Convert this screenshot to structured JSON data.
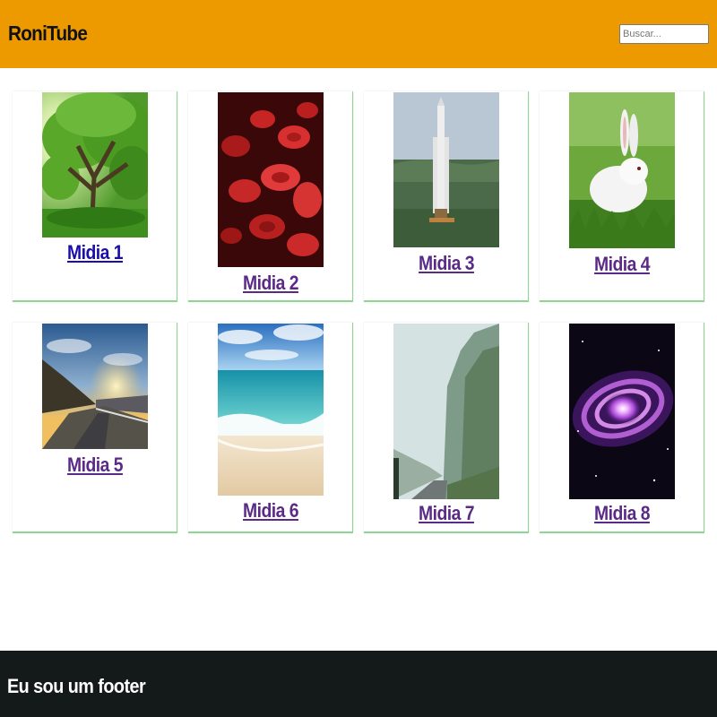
{
  "header": {
    "brand": "RoniTube",
    "background": "#ec9a00",
    "search": {
      "placeholder": "Buscar...",
      "value": ""
    }
  },
  "media": [
    {
      "label": "Midia 1",
      "image": "tree-image",
      "link_color": "#1a0dab"
    },
    {
      "label": "Midia 2",
      "image": "blood-cells-image",
      "link_color": "#5b2a86"
    },
    {
      "label": "Midia 3",
      "image": "rocket-launch-image",
      "link_color": "#5b2a86"
    },
    {
      "label": "Midia 4",
      "image": "white-rabbit-image",
      "link_color": "#5b2a86"
    },
    {
      "label": "Midia 5",
      "image": "mountain-road-sunset-image",
      "link_color": "#5b2a86"
    },
    {
      "label": "Midia 6",
      "image": "beach-image",
      "link_color": "#5b2a86"
    },
    {
      "label": "Midia 7",
      "image": "foggy-forest-road-image",
      "link_color": "#5b2a86"
    },
    {
      "label": "Midia 8",
      "image": "galaxy-image",
      "link_color": "#5b2a86"
    }
  ],
  "footer": {
    "text": "Eu sou um footer",
    "background": "#141a19"
  },
  "colors": {
    "card_border_accent": "#8fd694"
  }
}
